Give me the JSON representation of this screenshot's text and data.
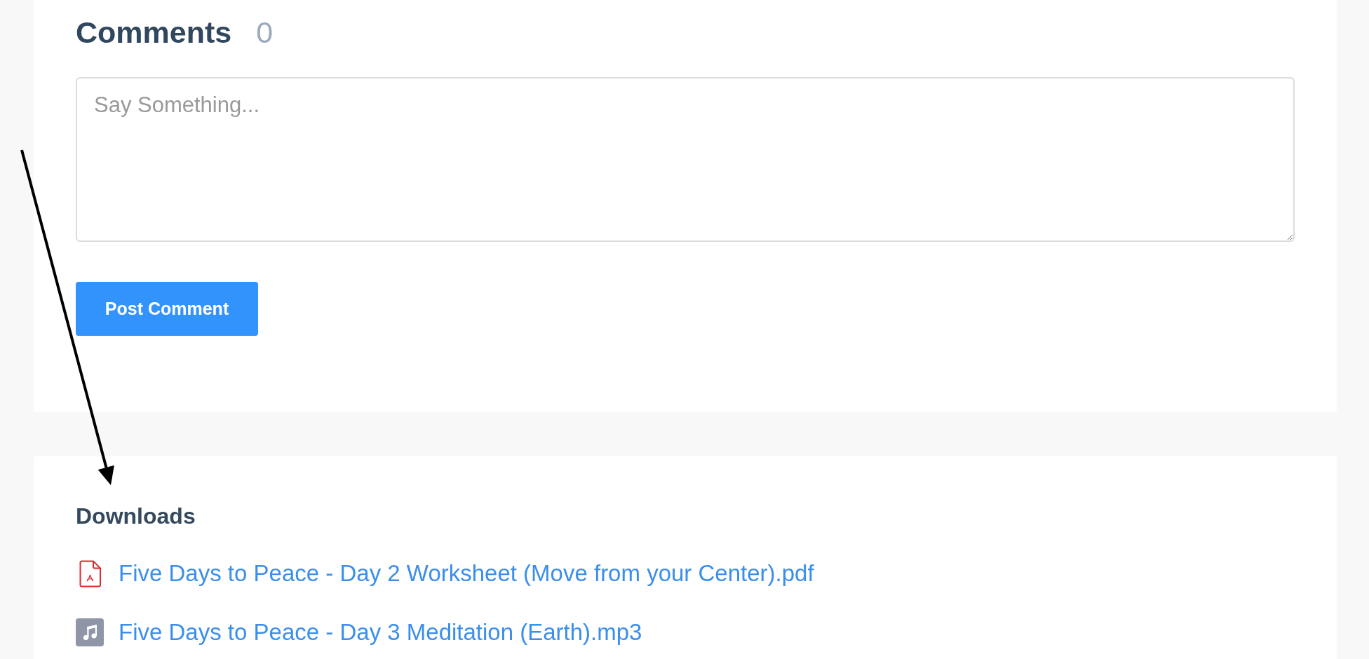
{
  "comments": {
    "title": "Comments",
    "count": "0",
    "input": {
      "placeholder": "Say Something..."
    },
    "submit_button": "Post Comment"
  },
  "downloads": {
    "title": "Downloads",
    "files": [
      {
        "kind": "pdf",
        "name": "Five Days to Peace - Day 2 Worksheet (Move from your Center).pdf"
      },
      {
        "kind": "audio",
        "name": "Five Days to Peace - Day 3 Meditation (Earth).mp3"
      }
    ]
  },
  "annotations": [
    {
      "kind": "arrow"
    }
  ]
}
